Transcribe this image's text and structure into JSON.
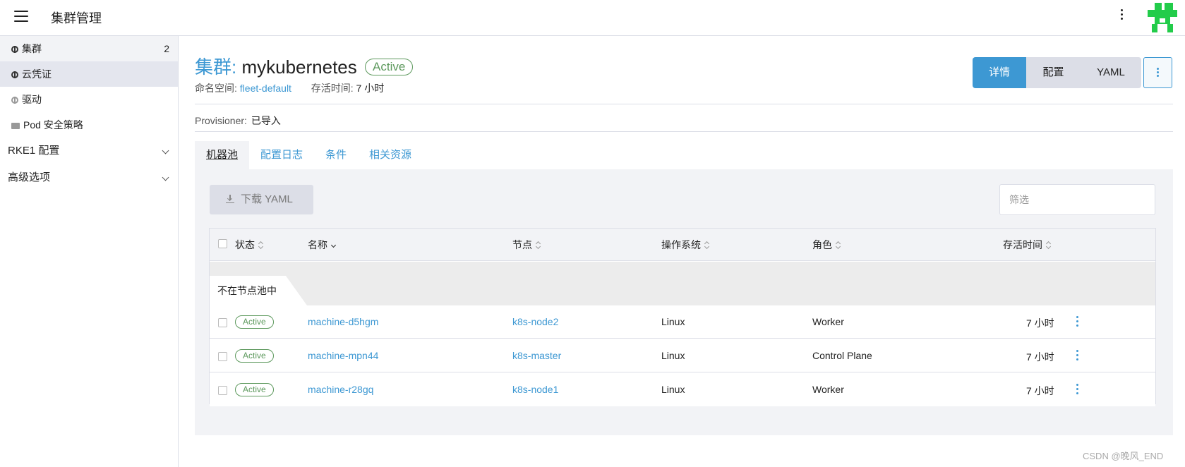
{
  "topbar": {
    "title": "集群管理"
  },
  "sidebar": {
    "items": [
      {
        "label": "集群",
        "count": "2",
        "icon": "globe-icon"
      },
      {
        "label": "云凭证",
        "icon": "globe-icon"
      },
      {
        "label": "驱动",
        "icon": "globe-icon"
      },
      {
        "label": "Pod 安全策略",
        "icon": "folder-icon"
      }
    ],
    "groups": [
      {
        "label": "RKE1 配置"
      },
      {
        "label": "高级选项"
      }
    ]
  },
  "header": {
    "prefix": "集群:",
    "name": "mykubernetes",
    "status": "Active",
    "namespace_label": "命名空间:",
    "namespace": "fleet-default",
    "age_label": "存活时间:",
    "age": "7 小时",
    "provisioner_label": "Provisioner:",
    "provisioner": "已导入"
  },
  "view_switch": {
    "detail": "详情",
    "config": "配置",
    "yaml": "YAML"
  },
  "tabs": [
    {
      "label": "机器池"
    },
    {
      "label": "配置日志"
    },
    {
      "label": "条件"
    },
    {
      "label": "相关资源"
    }
  ],
  "toolbar": {
    "download_label": "下载 YAML",
    "filter_placeholder": "筛选"
  },
  "table": {
    "columns": {
      "state": "状态",
      "name": "名称",
      "node": "节点",
      "os": "操作系统",
      "role": "角色",
      "age": "存活时间"
    },
    "group_label": "不在节点池中",
    "rows": [
      {
        "state": "Active",
        "name": "machine-d5hgm",
        "node": "k8s-node2",
        "os": "Linux",
        "role": "Worker",
        "age": "7 小时"
      },
      {
        "state": "Active",
        "name": "machine-mpn44",
        "node": "k8s-master",
        "os": "Linux",
        "role": "Control Plane",
        "age": "7 小时"
      },
      {
        "state": "Active",
        "name": "machine-r28gq",
        "node": "k8s-node1",
        "os": "Linux",
        "role": "Worker",
        "age": "7 小时"
      }
    ]
  },
  "watermark": "CSDN @晚风_END",
  "colors": {
    "accent": "#3d98d3",
    "active_green": "#5d995d",
    "logo_green": "#22cc4a"
  }
}
